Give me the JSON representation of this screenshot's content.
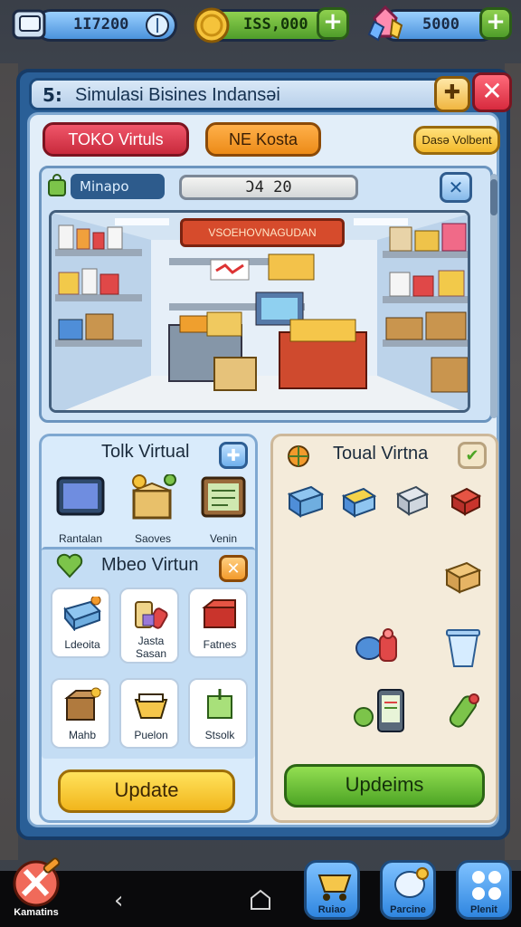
{
  "topbar": {
    "currency1": "1I7200",
    "currency2": "ISS,000",
    "currency3": "5000"
  },
  "panel": {
    "title": "Simulasi Bisines Indansəi",
    "title_glyph": "5:"
  },
  "tabs": {
    "tab1": "TOKO Virtuls",
    "tab2": "NE Kosta",
    "tab3": "Dasə Volbent"
  },
  "scene": {
    "label": "Minapo",
    "value": "Ͻ4 20",
    "sign": "VSOEHOVNAGUDAN"
  },
  "left": {
    "section1_title": "Tolk Virtual",
    "items1": [
      {
        "label": "Rantalan"
      },
      {
        "label": "Saoves"
      },
      {
        "label": "Venin"
      }
    ],
    "section2_title": "Mbeo Virtun",
    "items2": [
      {
        "label": "Ldeoita"
      },
      {
        "label": "Jasta\nSasan"
      },
      {
        "label": "Fatnes"
      },
      {
        "label": "Mahb"
      },
      {
        "label": "Puelon"
      },
      {
        "label": "Stsolk"
      }
    ],
    "button": "Update"
  },
  "right": {
    "title": "Toual Virtna",
    "button": "Updeims"
  },
  "nav": {
    "left_label": "Kamatins",
    "btn1": "Ruiao",
    "btn2": "Parcine",
    "btn3": "Plenit"
  },
  "colors": {
    "panel": "#2a5f97",
    "accent_green": "#4ea525",
    "accent_yellow": "#f1b51c",
    "accent_red": "#c82a3c"
  }
}
